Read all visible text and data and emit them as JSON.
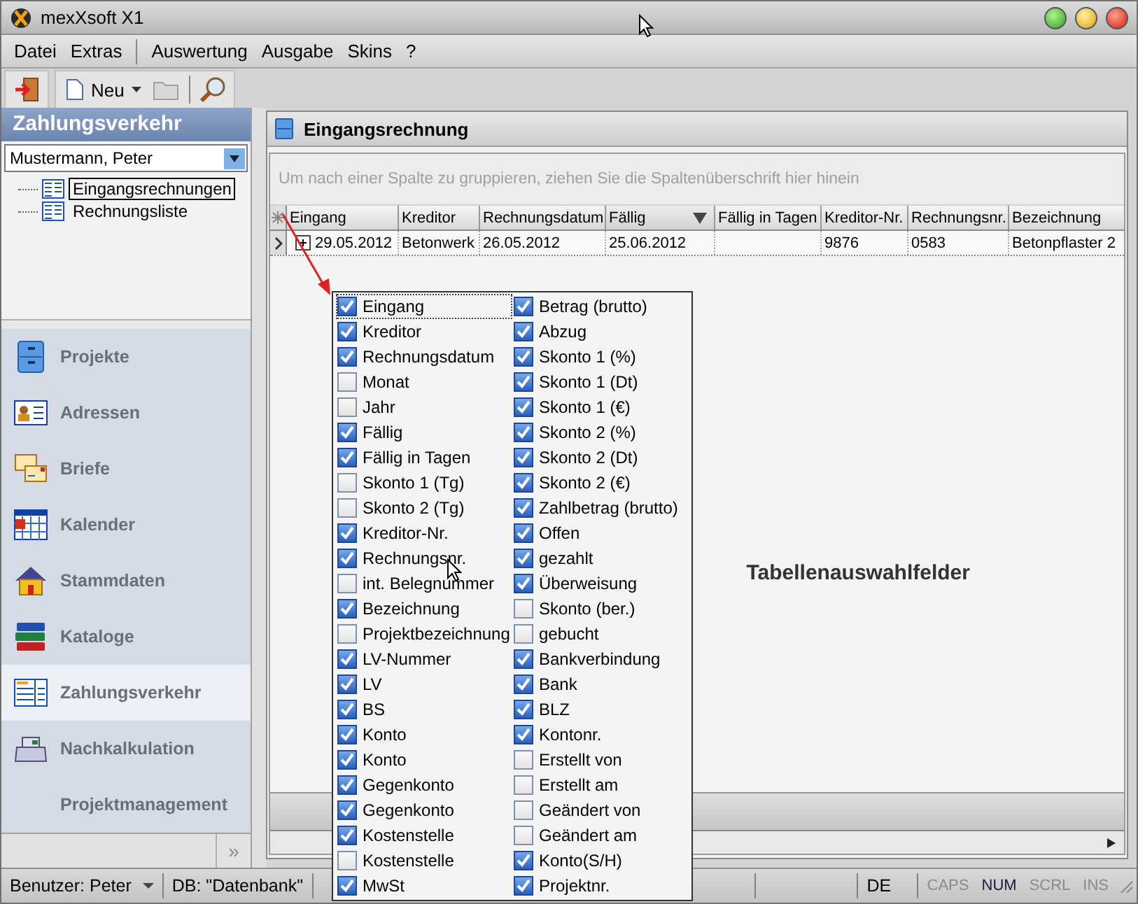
{
  "window": {
    "title": "mexXsoft X1"
  },
  "menu": [
    {
      "label": "Datei"
    },
    {
      "label": "Extras"
    },
    {
      "label": "Auswertung"
    },
    {
      "label": "Ausgabe"
    },
    {
      "label": "Skins"
    },
    {
      "label": "?"
    }
  ],
  "toolbar": {
    "new_button": "Neu"
  },
  "sidebar": {
    "title": "Zahlungsverkehr",
    "user_select": "Mustermann, Peter",
    "tree": [
      {
        "label": "Eingangsrechnungen",
        "selected": true
      },
      {
        "label": "Rechnungsliste",
        "selected": false
      }
    ],
    "nav": [
      {
        "label": "Projekte",
        "selected": false
      },
      {
        "label": "Adressen",
        "selected": false
      },
      {
        "label": "Briefe",
        "selected": false
      },
      {
        "label": "Kalender",
        "selected": false
      },
      {
        "label": "Stammdaten",
        "selected": false
      },
      {
        "label": "Kataloge",
        "selected": false
      },
      {
        "label": "Zahlungsverkehr",
        "selected": true
      },
      {
        "label": "Nachkalkulation",
        "selected": false
      },
      {
        "label": "Projektmanagement",
        "selected": false
      }
    ],
    "more_button": "»"
  },
  "panel": {
    "title": "Eingangsrechnung",
    "group_hint": "Um nach einer Spalte zu gruppieren, ziehen Sie die Spaltenüberschrift hier hinein",
    "table": {
      "columns": [
        {
          "label": "Eingang",
          "sorted": false
        },
        {
          "label": "Kreditor",
          "sorted": false
        },
        {
          "label": "Rechnungsdatum",
          "sorted": false
        },
        {
          "label": "Fällig",
          "sorted": true
        },
        {
          "label": "Fällig in Tagen",
          "sorted": false
        },
        {
          "label": "Kreditor-Nr.",
          "sorted": false
        },
        {
          "label": "Rechnungsnr.",
          "sorted": false
        },
        {
          "label": "Bezeichnung",
          "sorted": false
        }
      ],
      "rows": [
        [
          "29.05.2012",
          "Betonwerk",
          "26.05.2012",
          "25.06.2012",
          "",
          "9876",
          "0583",
          "Betonpflaster 2"
        ]
      ]
    },
    "annotation": "Tabellenauswahlfelder"
  },
  "column_chooser": [
    [
      {
        "label": "Eingang",
        "checked": true,
        "focused": true
      },
      {
        "label": "Kreditor",
        "checked": true,
        "focused": false
      },
      {
        "label": "Rechnungsdatum",
        "checked": true,
        "focused": false
      },
      {
        "label": "Monat",
        "checked": false,
        "focused": false
      },
      {
        "label": "Jahr",
        "checked": false,
        "focused": false
      },
      {
        "label": "Fällig",
        "checked": true,
        "focused": false
      },
      {
        "label": "Fällig in Tagen",
        "checked": true,
        "focused": false
      },
      {
        "label": "Skonto 1 (Tg)",
        "checked": false,
        "focused": false
      },
      {
        "label": "Skonto 2 (Tg)",
        "checked": false,
        "focused": false
      },
      {
        "label": "Kreditor-Nr.",
        "checked": true,
        "focused": false
      },
      {
        "label": "Rechnungsnr.",
        "checked": true,
        "focused": false
      },
      {
        "label": "int. Belegnummer",
        "checked": false,
        "focused": false
      },
      {
        "label": "Bezeichnung",
        "checked": true,
        "focused": false
      },
      {
        "label": "Projektbezeichnung",
        "checked": false,
        "focused": false
      },
      {
        "label": "LV-Nummer",
        "checked": true,
        "focused": false
      },
      {
        "label": "LV",
        "checked": true,
        "focused": false
      },
      {
        "label": "BS",
        "checked": true,
        "focused": false
      },
      {
        "label": "Konto",
        "checked": true,
        "focused": false
      },
      {
        "label": "Konto",
        "checked": true,
        "focused": false
      },
      {
        "label": "Gegenkonto",
        "checked": true,
        "focused": false
      },
      {
        "label": "Gegenkonto",
        "checked": true,
        "focused": false
      },
      {
        "label": "Kostenstelle",
        "checked": true,
        "focused": false
      },
      {
        "label": "Kostenstelle",
        "checked": false,
        "focused": false
      },
      {
        "label": "MwSt",
        "checked": true,
        "focused": false
      }
    ],
    [
      {
        "label": "Betrag (brutto)",
        "checked": true,
        "focused": false
      },
      {
        "label": "Abzug",
        "checked": true,
        "focused": false
      },
      {
        "label": "Skonto 1 (%)",
        "checked": true,
        "focused": false
      },
      {
        "label": "Skonto 1 (Dt)",
        "checked": true,
        "focused": false
      },
      {
        "label": "Skonto 1 (€)",
        "checked": true,
        "focused": false
      },
      {
        "label": "Skonto 2 (%)",
        "checked": true,
        "focused": false
      },
      {
        "label": "Skonto 2 (Dt)",
        "checked": true,
        "focused": false
      },
      {
        "label": "Skonto 2 (€)",
        "checked": true,
        "focused": false
      },
      {
        "label": "Zahlbetrag (brutto)",
        "checked": true,
        "focused": false
      },
      {
        "label": "Offen",
        "checked": true,
        "focused": false
      },
      {
        "label": "gezahlt",
        "checked": true,
        "focused": false
      },
      {
        "label": "Überweisung",
        "checked": true,
        "focused": false
      },
      {
        "label": "Skonto (ber.)",
        "checked": false,
        "focused": false
      },
      {
        "label": "gebucht",
        "checked": false,
        "focused": false
      },
      {
        "label": "Bankverbindung",
        "checked": true,
        "focused": false
      },
      {
        "label": "Bank",
        "checked": true,
        "focused": false
      },
      {
        "label": "BLZ",
        "checked": true,
        "focused": false
      },
      {
        "label": "Kontonr.",
        "checked": true,
        "focused": false
      },
      {
        "label": "Erstellt von",
        "checked": false,
        "focused": false
      },
      {
        "label": "Erstellt am",
        "checked": false,
        "focused": false
      },
      {
        "label": "Geändert von",
        "checked": false,
        "focused": false
      },
      {
        "label": "Geändert am",
        "checked": false,
        "focused": false
      },
      {
        "label": "Konto(S/H)",
        "checked": true,
        "focused": false
      },
      {
        "label": "Projektnr.",
        "checked": true,
        "focused": false
      }
    ]
  ],
  "status_bar": {
    "user": "Benutzer: Peter",
    "database": "DB: \"Datenbank\"",
    "language": "DE",
    "keys": [
      {
        "label": "CAPS",
        "on": false
      },
      {
        "label": "NUM",
        "on": true
      },
      {
        "label": "SCRL",
        "on": false
      },
      {
        "label": "INS",
        "on": false
      }
    ]
  }
}
